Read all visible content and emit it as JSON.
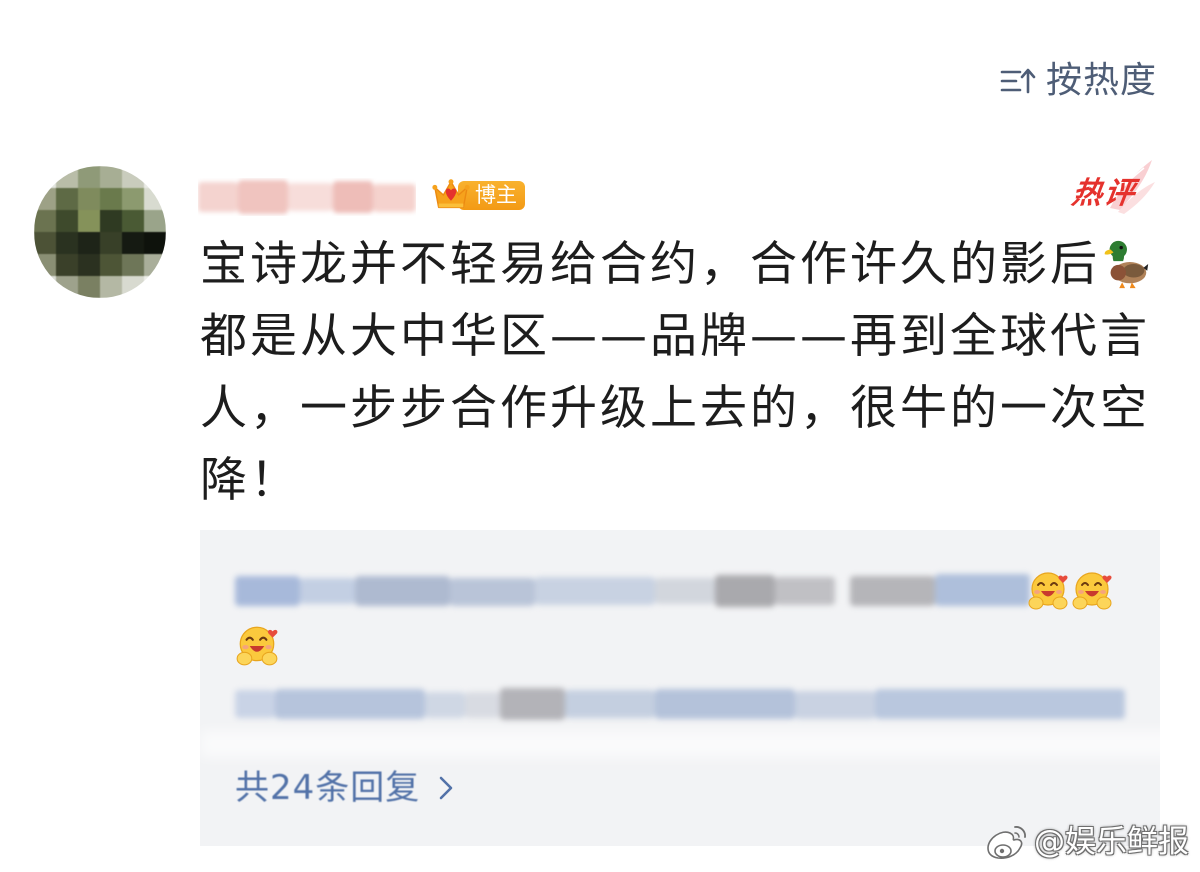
{
  "sort": {
    "icon": "sort-icon",
    "label": "按热度",
    "color": "#4e5d76"
  },
  "comment": {
    "avatar": "avatar-blurred",
    "author_badge": {
      "icon": "crown-icon",
      "label": "博主",
      "color": "#f6a21c"
    },
    "hot_badge": {
      "label": "热评",
      "color": "#e5322d"
    },
    "lines": [
      "宝诗龙并不轻易给合约，合作许久的影后",
      "都是从大中华区——品牌——再到全球代言",
      "人，一步步合作升级上去的，很牛的一次空",
      "降！"
    ],
    "inline_emoji": "duck-emoji-icon",
    "text_color": "#1d1d1d"
  },
  "replies": {
    "background": "#f2f3f5",
    "preview_emojis": [
      "hug-emoji-icon",
      "hug-emoji-icon",
      "hug-emoji-icon"
    ],
    "more_label": "共24条回复",
    "more_icon": "chevron-right-icon",
    "link_color": "#5272a8"
  },
  "watermark": {
    "logo": "weibo-logo-icon",
    "text": "@娱乐鲜报"
  }
}
